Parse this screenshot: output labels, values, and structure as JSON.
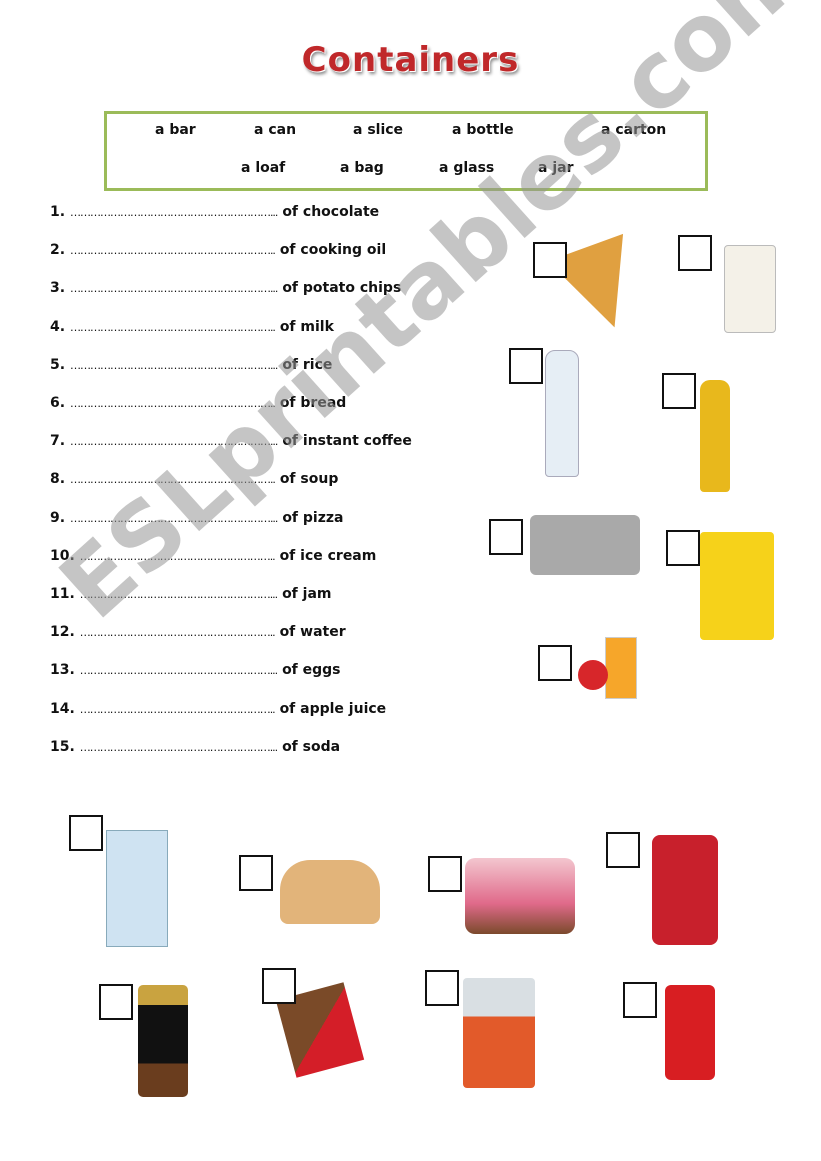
{
  "title": "Containers",
  "word_bank": [
    "a bar",
    "a can",
    "a slice",
    "a bottle",
    "a carton",
    "a loaf",
    "a bag",
    "a glass",
    "a jar"
  ],
  "exercise": [
    {
      "num": "1.",
      "dots": "……………………………………………………...",
      "suffix": "of chocolate"
    },
    {
      "num": "2.",
      "dots": "……………………………………………………..",
      "suffix": "of cooking oil"
    },
    {
      "num": "3.",
      "dots": "……………………………………………………...",
      "suffix": "of potato chips"
    },
    {
      "num": "4.",
      "dots": "……………………………………………………..",
      "suffix": "of milk"
    },
    {
      "num": "5.",
      "dots": "……………………………………………………...",
      "suffix": "of rice"
    },
    {
      "num": "6.",
      "dots": "……………………………………………………..",
      "suffix": "of bread"
    },
    {
      "num": "7.",
      "dots": "……………………………………………………...",
      "suffix": "of instant coffee"
    },
    {
      "num": "8.",
      "dots": "……………………………………………………..",
      "suffix": "of soup"
    },
    {
      "num": "9.",
      "dots": "……………………………………………………...",
      "suffix": "of pizza"
    },
    {
      "num": "10.",
      "dots": "…………………………………………………..",
      "suffix": "of ice cream"
    },
    {
      "num": "11.",
      "dots": "…………………………………………………...",
      "suffix": "of jam"
    },
    {
      "num": "12.",
      "dots": "…………………………………………………..",
      "suffix": "of water"
    },
    {
      "num": "13.",
      "dots": "…………………………………………………...",
      "suffix": "of eggs"
    },
    {
      "num": "14.",
      "dots": "…………………………………………………..",
      "suffix": "of apple juice"
    },
    {
      "num": "15.",
      "dots": "…………………………………………………...",
      "suffix": "of soda"
    }
  ],
  "watermark": "ESLprintables.com",
  "pictures": [
    "pizza-slice",
    "rice-bag",
    "water-bottle",
    "cooking-oil-bottle",
    "egg-carton",
    "potato-chips-bag",
    "apple-juice-glass",
    "milk-carton",
    "bread-loaf",
    "ice-cream-tub",
    "jam-jar",
    "coffee-jar",
    "chocolate-bar",
    "soup-can",
    "soda-can"
  ]
}
